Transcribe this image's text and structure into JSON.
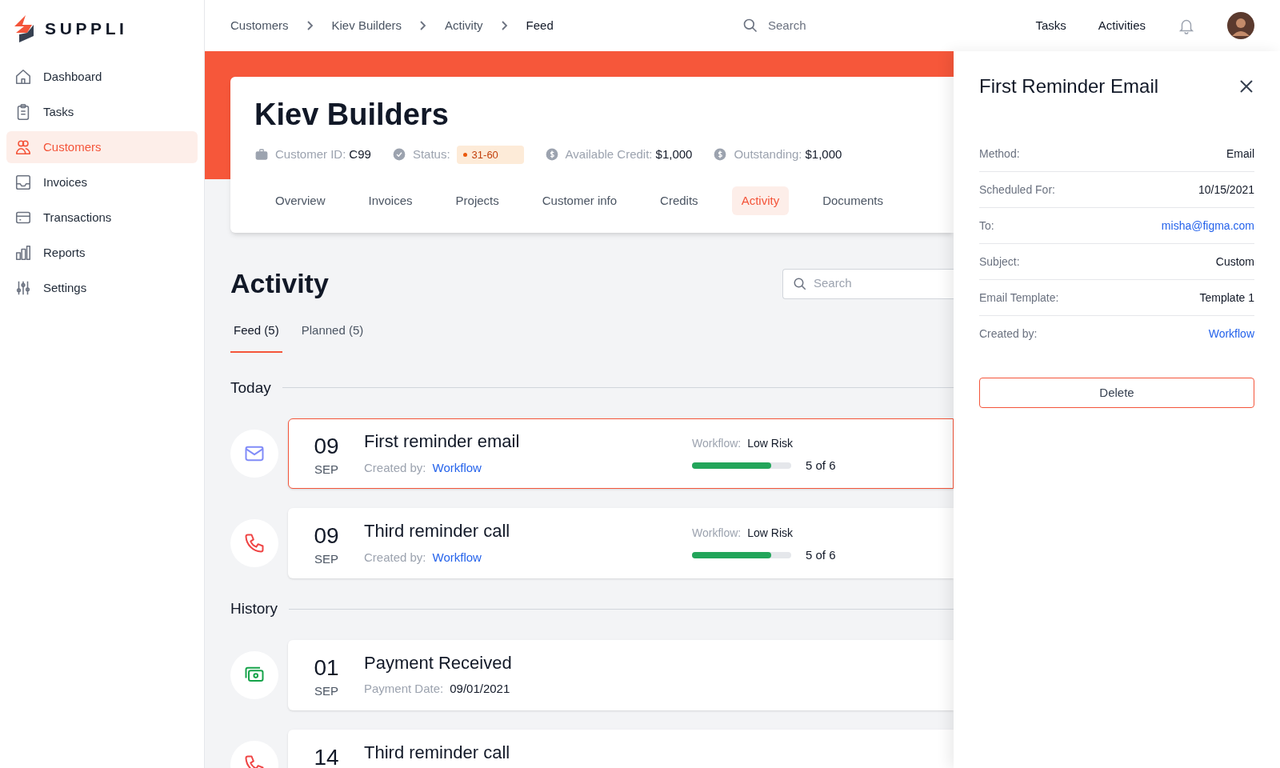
{
  "brand": "SUPPLI",
  "sidebar": {
    "items": [
      {
        "label": "Dashboard",
        "selected": false
      },
      {
        "label": "Tasks",
        "selected": false
      },
      {
        "label": "Customers",
        "selected": true
      },
      {
        "label": "Invoices",
        "selected": false
      },
      {
        "label": "Transactions",
        "selected": false
      },
      {
        "label": "Reports",
        "selected": false
      },
      {
        "label": "Settings",
        "selected": false
      }
    ]
  },
  "breadcrumbs": [
    {
      "label": "Customers",
      "current": false
    },
    {
      "label": "Kiev Builders",
      "current": false
    },
    {
      "label": "Activity",
      "current": false
    },
    {
      "label": "Feed",
      "current": true
    }
  ],
  "header": {
    "search_placeholder": "Search",
    "links": [
      "Tasks",
      "Activities"
    ]
  },
  "customer": {
    "name": "Kiev Builders",
    "meta": [
      {
        "kind": "text",
        "label": "Customer ID:",
        "value": "C99"
      },
      {
        "kind": "badge",
        "label": "Status:",
        "value": "31-60"
      },
      {
        "kind": "text",
        "label": "Available Credit:",
        "value": "$1,000"
      },
      {
        "kind": "text",
        "label": "Outstanding:",
        "value": "$1,000"
      }
    ],
    "tabs": [
      {
        "label": "Overview",
        "selected": false
      },
      {
        "label": "Invoices",
        "selected": false
      },
      {
        "label": "Projects",
        "selected": false
      },
      {
        "label": "Customer info",
        "selected": false
      },
      {
        "label": "Credits",
        "selected": false
      },
      {
        "label": "Activity",
        "selected": true
      },
      {
        "label": "Documents",
        "selected": false
      }
    ]
  },
  "activity": {
    "title": "Activity",
    "search_placeholder": "Search",
    "tabs": [
      {
        "label": "Feed (5)",
        "selected": true
      },
      {
        "label": "Planned (5)",
        "selected": false
      }
    ],
    "groups": [
      {
        "title": "Today",
        "items": [
          {
            "kind": "email",
            "day": "09",
            "month": "SEP",
            "title": "First reminder email",
            "selected": true,
            "detail_label": "Created by:",
            "detail_value": "Workflow",
            "detail_link": true,
            "workflow_label": "Workflow:",
            "workflow_value": "Low Risk",
            "level": 0.8,
            "progress_text": "5 of 6"
          },
          {
            "kind": "call",
            "day": "09",
            "month": "SEP",
            "title": "Third reminder call",
            "selected": false,
            "detail_label": "Created by:",
            "detail_value": "Workflow",
            "detail_link": true,
            "workflow_label": "Workflow:",
            "workflow_value": "Low Risk",
            "level": 0.8,
            "progress_text": "5 of 6"
          }
        ]
      },
      {
        "title": "History",
        "items": [
          {
            "kind": "payment",
            "day": "01",
            "month": "SEP",
            "title": "Payment Received",
            "selected": false,
            "detail_label": "Payment Date:",
            "detail_value": "09/01/2021",
            "detail_link": false
          },
          {
            "kind": "call",
            "day": "14",
            "title": "Third reminder call",
            "selected": false
          }
        ]
      }
    ]
  },
  "panel": {
    "title": "First Reminder Email",
    "fields": [
      {
        "label": "Method:",
        "value": "Email",
        "link": false
      },
      {
        "label": "Scheduled For:",
        "value": "10/15/2021",
        "link": false
      },
      {
        "label": "To:",
        "value": "misha@figma.com",
        "link": true
      },
      {
        "label": "Subject:",
        "value": "Custom",
        "link": false
      },
      {
        "label": "Email Template:",
        "value": "Template 1",
        "link": false
      },
      {
        "label": "Created by:",
        "value": "Workflow",
        "link": true
      }
    ],
    "button": "Delete"
  }
}
